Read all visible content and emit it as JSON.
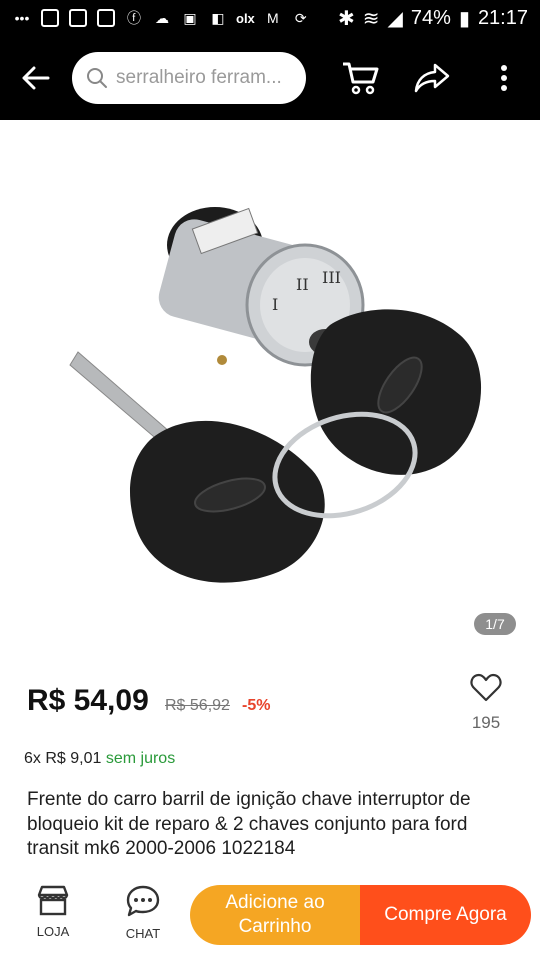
{
  "status_bar": {
    "notification_icons": [
      "notification-icon",
      "mail-icon",
      "mail-icon",
      "mail-icon",
      "facebook-icon",
      "cloud-icon",
      "alert-icon",
      "flipboard-icon",
      "olx-icon",
      "gmail-icon",
      "sync-icon"
    ],
    "olx_text": "olx",
    "battery": "74%",
    "time": "21:17"
  },
  "top_bar": {
    "search_placeholder": "serralheiro ferram..."
  },
  "gallery": {
    "counter": "1/7"
  },
  "product": {
    "price": "R$ 54,09",
    "old_price": "R$ 56,92",
    "discount": "-5%",
    "wishlist_count": "195",
    "installments_prefix": "6x R$ 9,01",
    "installments_suffix": "sem juros",
    "title": "Frente do carro barril de ignição chave interruptor de bloqueio kit de reparo & 2 chaves conjunto para ford transit mk6 2000-2006 1022184"
  },
  "bottom_bar": {
    "shop_label": "LOJA",
    "chat_label": "CHAT",
    "add_to_cart": "Adicione ao Carrinho",
    "buy_now": "Compre Agora"
  },
  "colors": {
    "accent_orange": "#f5a623",
    "accent_red": "#ff4f1b",
    "discount_red": "#e8442c",
    "green": "#2a9a3a"
  }
}
